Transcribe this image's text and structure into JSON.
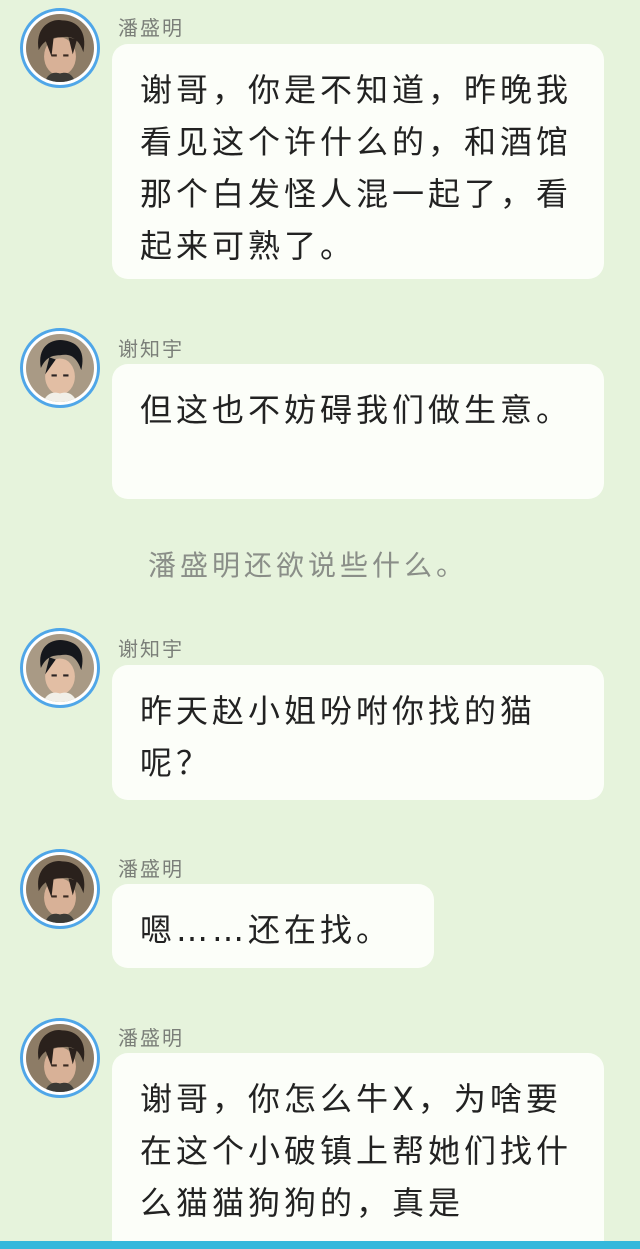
{
  "messages": [
    {
      "speaker": "潘盛明",
      "avatar_icon": "dark-hair-boy-avatar-icon",
      "text": "谢哥，你是不知道，昨晚我看见这个许什么的，和酒馆那个白发怪人混一起了，看起来可熟了。"
    },
    {
      "speaker": "谢知宇",
      "avatar_icon": "black-hair-boy-avatar-icon",
      "text": "但这也不妨碍我们做生意。"
    },
    {
      "speaker": "谢知宇",
      "avatar_icon": "black-hair-boy-avatar-icon",
      "text": "昨天赵小姐吩咐你找的猫呢？"
    },
    {
      "speaker": "潘盛明",
      "avatar_icon": "dark-hair-boy-avatar-icon",
      "text": "嗯……还在找。"
    },
    {
      "speaker": "潘盛明",
      "avatar_icon": "dark-hair-boy-avatar-icon",
      "text": "谢哥，你怎么牛X，为啥要在这个小破镇上帮她们找什么猫猫狗狗的，真是"
    }
  ],
  "narration": "潘盛明还欲说些什么。",
  "colors": {
    "background": "#e6f3dc",
    "bubble": "#fcfef9",
    "avatar_ring": "#4fa6e8",
    "bottom_bar": "#35b8dc"
  }
}
